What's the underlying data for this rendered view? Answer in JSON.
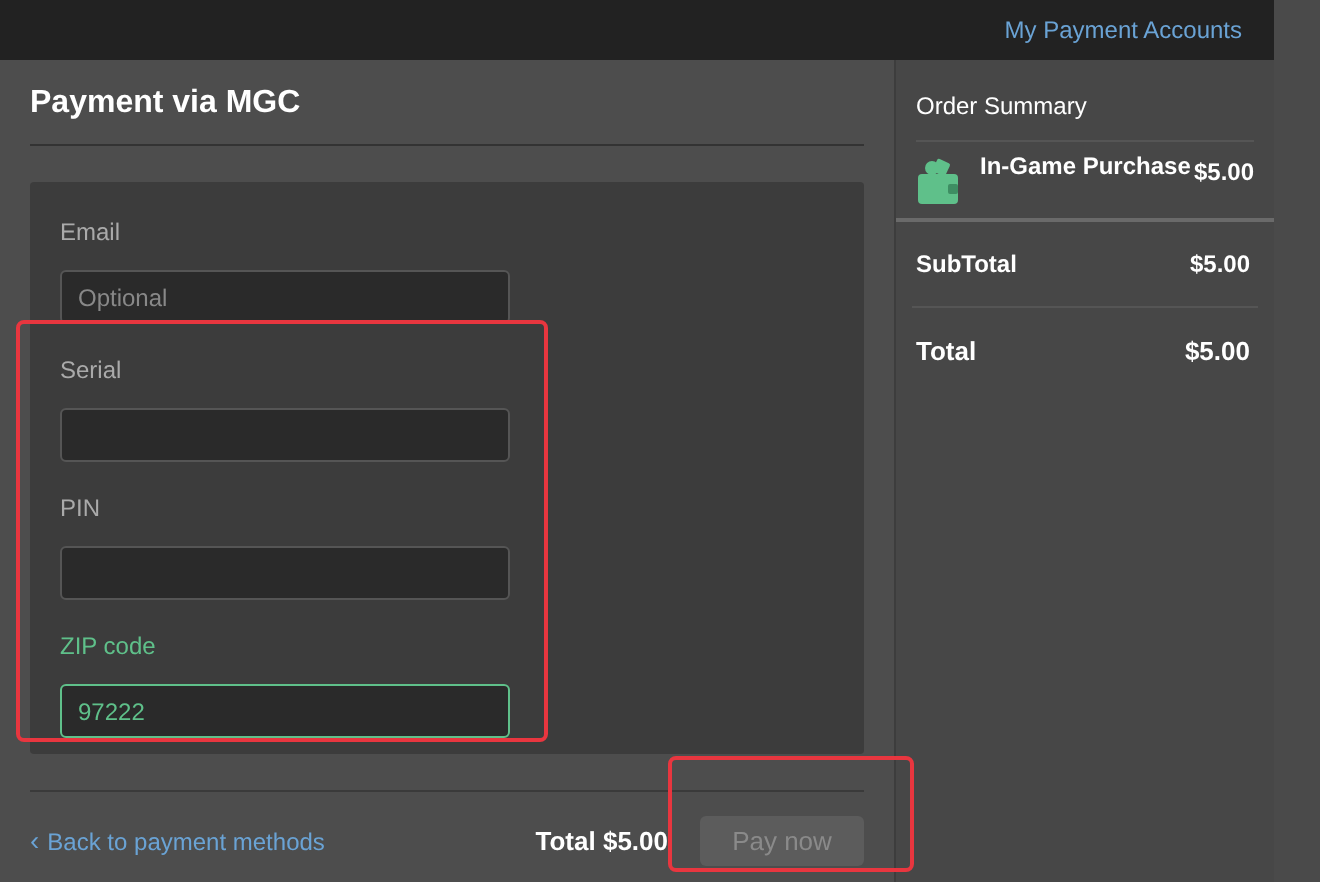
{
  "header": {
    "link": "My Payment Accounts"
  },
  "payment": {
    "title": "Payment via MGC",
    "fields": [
      {
        "label": "Email",
        "placeholder": "Optional",
        "focused": false
      },
      {
        "label": "Serial",
        "focused": false
      },
      {
        "label": "PIN",
        "focused": false
      },
      {
        "label": "ZIP code",
        "value": "97222",
        "focused": true
      }
    ],
    "back_link": "Back to payment methods",
    "back_icon": "‹",
    "total": "Total $5.00",
    "pay_button": {
      "label": "Pay now",
      "disabled": true
    }
  },
  "order_summary": {
    "title": "Order Summary",
    "items": [
      {
        "name": "In-Game Purchase",
        "price": "$5.00"
      }
    ],
    "subtotal": {
      "label": "SubTotal",
      "value": "$5.00"
    },
    "total": {
      "label": "Total",
      "value": "$5.00"
    }
  }
}
